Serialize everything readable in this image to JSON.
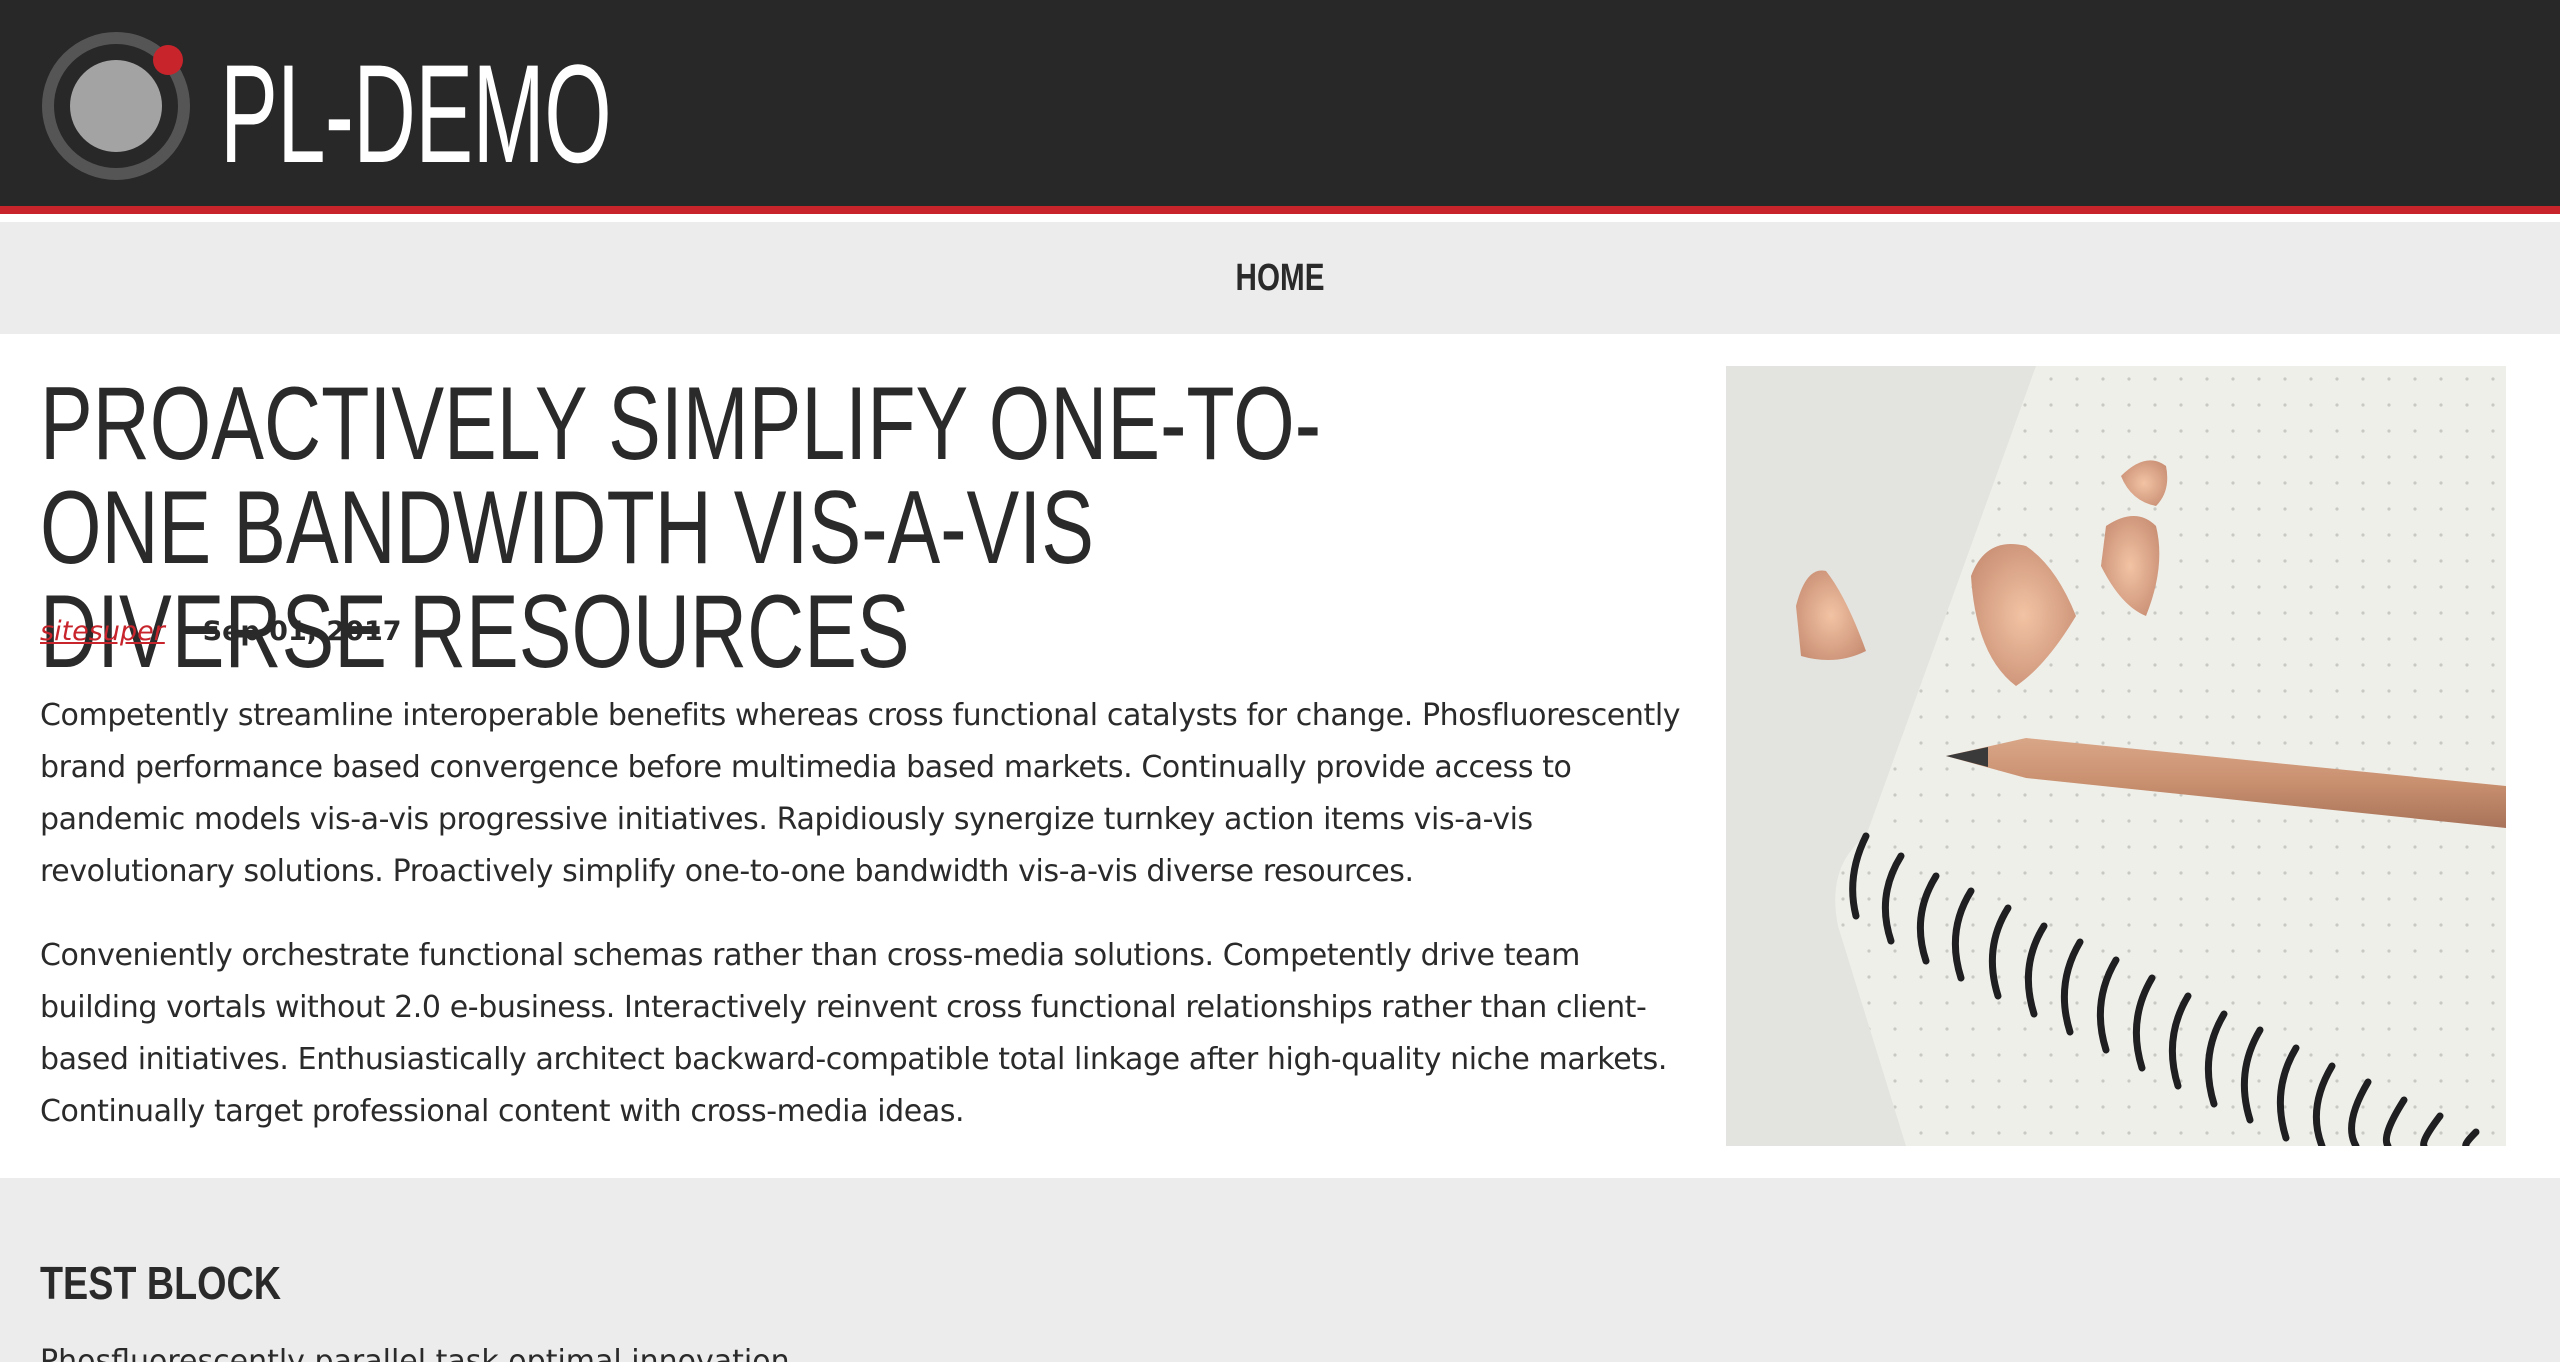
{
  "header": {
    "site_title": "PL-DEMO",
    "logo_icon": "record-dot-icon",
    "accent_color": "#c8242c",
    "background_color": "#282828"
  },
  "nav": {
    "items": [
      {
        "label": "HOME"
      }
    ]
  },
  "article": {
    "title": "PROACTIVELY SIMPLIFY ONE-TO-ONE BANDWIDTH VIS-A-VIS DIVERSE RESOURCES",
    "author": "sitesuper",
    "separator": "|",
    "date": "Sep 01, 2017",
    "paragraphs": [
      "Competently streamline interoperable benefits whereas cross functional catalysts for change. Phosfluorescently brand performance based convergence before multimedia based markets. Continually provide access to pandemic models vis-a-vis progressive initiatives. Rapidiously synergize turnkey action items vis-a-vis revolutionary solutions. Proactively simplify one-to-one bandwidth vis-a-vis diverse resources.",
      "Conveniently orchestrate functional schemas rather than cross-media solutions. Competently drive team building vortals without 2.0 e-business. Interactively reinvent cross functional relationships rather than client-based initiatives. Enthusiastically architect backward-compatible total linkage after high-quality niche markets. Continually target professional content with cross-media ideas."
    ],
    "image": {
      "subject": "notebook-pencil-shavings-photo"
    }
  },
  "test_block": {
    "heading": "TEST BLOCK",
    "text": "Phosfluorescently parallel task optimal innovation"
  }
}
